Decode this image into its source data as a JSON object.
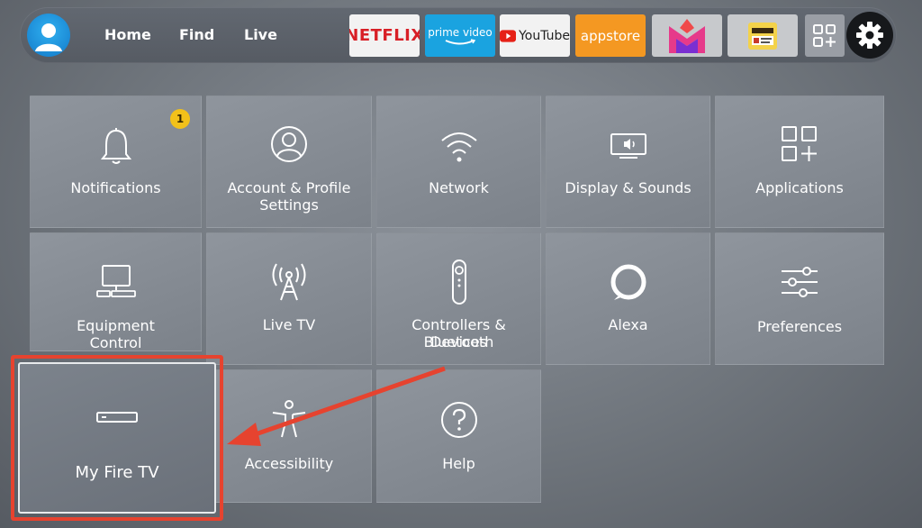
{
  "nav": {
    "home": "Home",
    "find": "Find",
    "live": "Live"
  },
  "apps": {
    "netflix": "NETFLIX",
    "prime_line1": "prime video",
    "youtube": "YouTube",
    "appstore": "appstore"
  },
  "icons": {
    "avatar": "user-avatar-icon",
    "all_apps": "all-apps-grid-icon",
    "settings": "gear-icon"
  },
  "settings_tiles": {
    "notifications": {
      "label": "Notifications",
      "badge": "1"
    },
    "account": {
      "label_line1": "Account & Profile",
      "label_line2": "Settings"
    },
    "network": {
      "label": "Network"
    },
    "display": {
      "label": "Display & Sounds"
    },
    "applications": {
      "label": "Applications"
    },
    "equipment": {
      "label_line1": "Equipment",
      "label_line2": "Control"
    },
    "livetv": {
      "label": "Live TV"
    },
    "controllers": {
      "label_line1": "Controllers & Bluetooth",
      "label_line2": "Devices"
    },
    "alexa": {
      "label": "Alexa"
    },
    "preferences": {
      "label": "Preferences"
    },
    "myfiretv": {
      "label": "My Fire TV"
    },
    "accessibility": {
      "label": "Accessibility"
    },
    "help": {
      "label": "Help"
    }
  },
  "colors": {
    "highlight": "#e6432f",
    "badge": "#f2c11a",
    "tile": "#848a92"
  }
}
